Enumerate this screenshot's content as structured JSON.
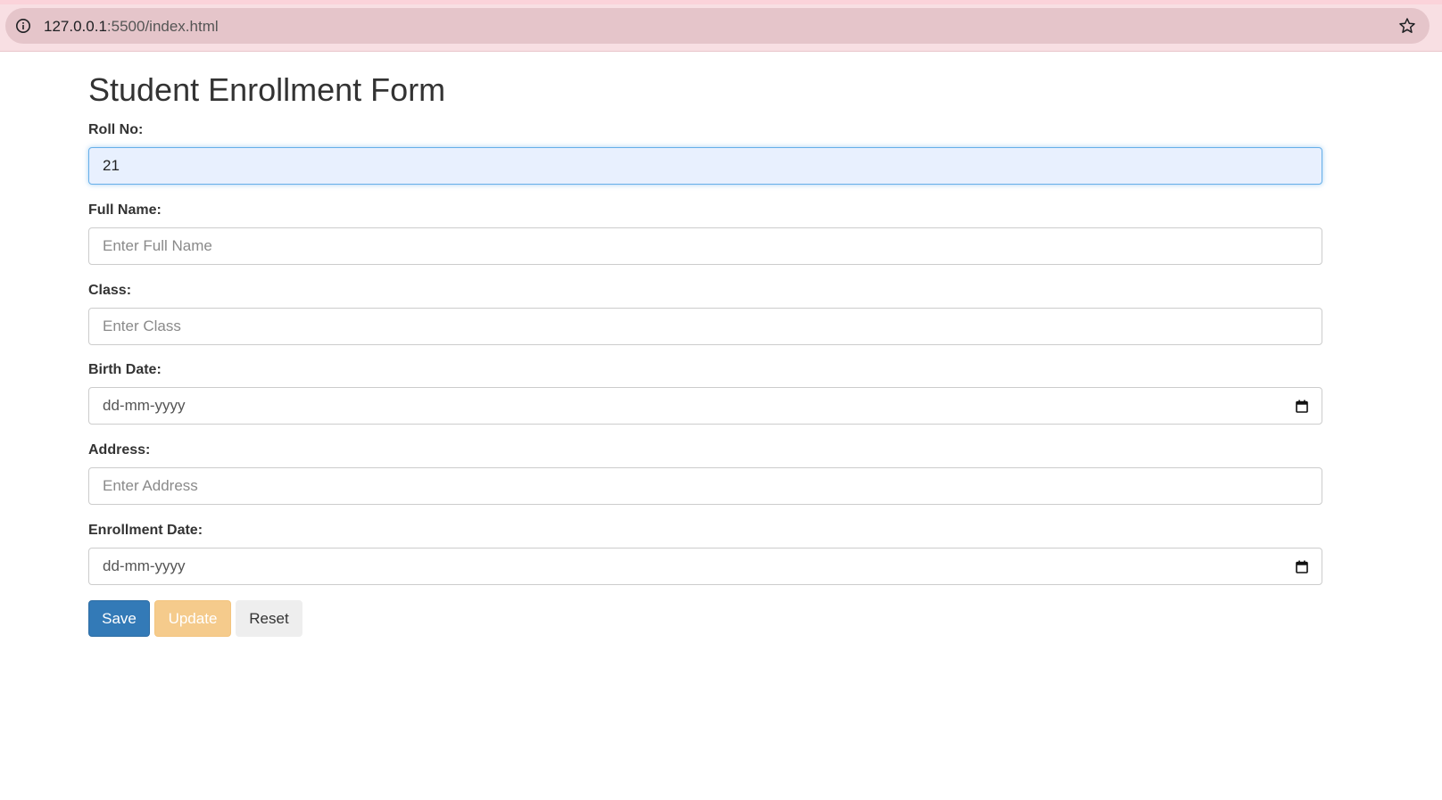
{
  "browser": {
    "url_host": "127.0.0.1",
    "url_rest": ":5500/index.html"
  },
  "form": {
    "title": "Student Enrollment Form",
    "fields": {
      "roll_no": {
        "label": "Roll No:",
        "value": "21",
        "placeholder": ""
      },
      "full_name": {
        "label": "Full Name:",
        "value": "",
        "placeholder": "Enter Full Name"
      },
      "class": {
        "label": "Class:",
        "value": "",
        "placeholder": "Enter Class"
      },
      "birth_date": {
        "label": "Birth Date:",
        "value": "",
        "placeholder": "dd-mm-yyyy"
      },
      "address": {
        "label": "Address:",
        "value": "",
        "placeholder": "Enter Address"
      },
      "enrollment_date": {
        "label": "Enrollment Date:",
        "value": "",
        "placeholder": "dd-mm-yyyy"
      }
    },
    "buttons": {
      "save": "Save",
      "update": "Update",
      "reset": "Reset"
    }
  },
  "colors": {
    "save": "#337ab7",
    "update": "#f5cb8c",
    "reset": "#eeeeee",
    "focus_bg": "#e8f0fe",
    "browser_bar": "#f8dfe3"
  },
  "icons": {
    "site_info": "info-icon",
    "bookmark": "star-icon",
    "date_picker": "calendar-icon"
  }
}
